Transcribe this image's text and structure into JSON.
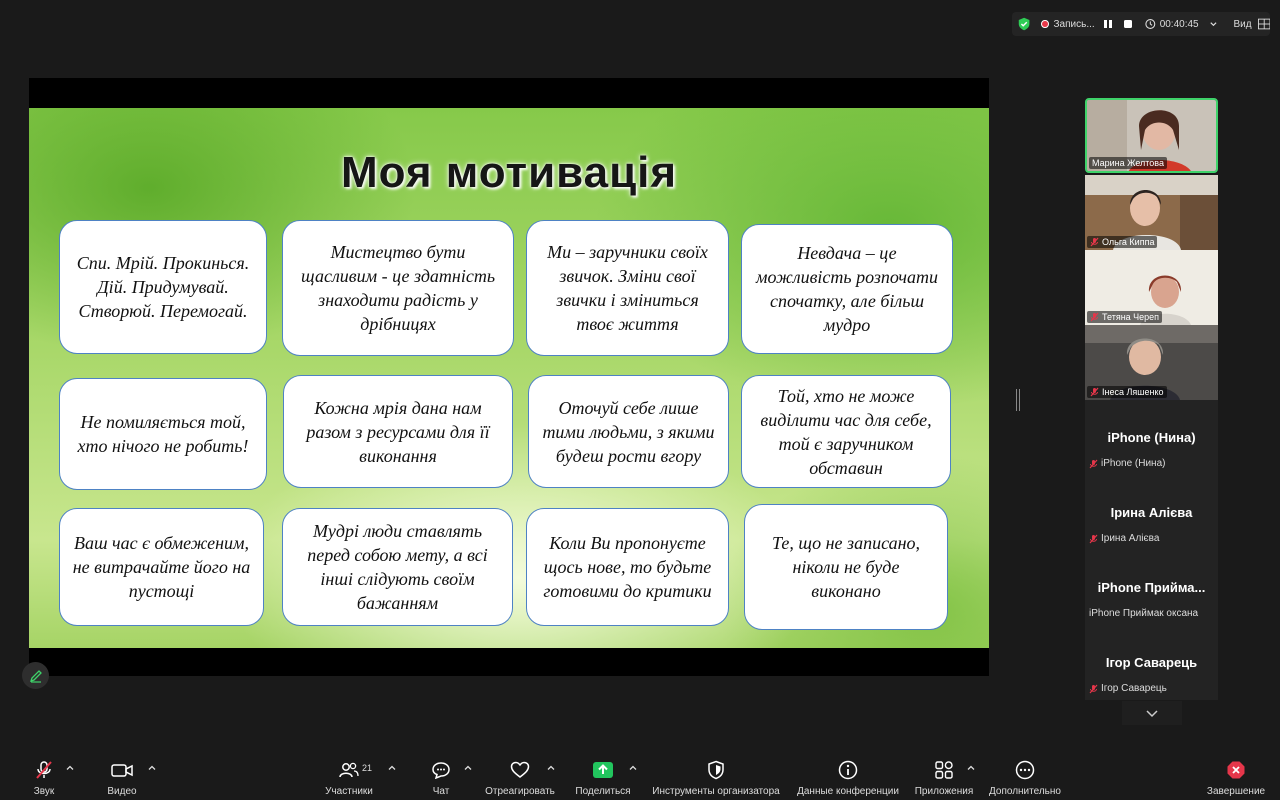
{
  "status_bar": {
    "recording_label": "Запись...",
    "timer": "00:40:45",
    "view_label": "Вид"
  },
  "slide": {
    "title": "Моя мотивація",
    "cards": [
      "Спи. Мрій. Прокинься. Дій. Придумувай. Створюй. Перемогай.",
      "Мистецтво бути щасливим - це здатність знаходити радість у дрібницях",
      "Ми – заручники своїх звичок. Зміни свої звички і зміниться твоє життя",
      "Невдача – це можливість розпочати спочатку, але більш мудро",
      "Не помиляється той, хто нічого не робить!",
      "Кожна мрія дана нам разом з ресурсами для її виконання",
      "Оточуй себе лише тими людьми, з якими будеш рости вгору",
      "Той, хто не може виділити час для себе, той є заручником обставин",
      "Ваш час є обмеженим, не витрачайте його на пустощі",
      "Мудрі люди ставлять перед собою мету, а всі інші слідують своїм бажанням",
      "Коли Ви пропонуєте щось нове, то будьте готовими до критики",
      "Те, що не записано, ніколи не буде виконано"
    ]
  },
  "participants": {
    "videos": [
      {
        "name": "Марина Желтова",
        "muted": false
      },
      {
        "name": "Ольга Киппа",
        "muted": true
      },
      {
        "name": "Тетяна Череп",
        "muted": true
      },
      {
        "name": "Інеса Ляшенко",
        "muted": true
      }
    ],
    "tiles": [
      {
        "display": "iPhone (Нина)",
        "name": "iPhone (Нина)",
        "muted": true
      },
      {
        "display": "Ірина Алієва",
        "name": "Ірина Алієва",
        "muted": true
      },
      {
        "display": "iPhone Прийма...",
        "name": "iPhone Приймак оксана",
        "muted": false
      },
      {
        "display": "Ігор Саварець",
        "name": "Ігор Саварець",
        "muted": true
      }
    ]
  },
  "toolbar": {
    "audio": "Звук",
    "video": "Видео",
    "participants": "Участники",
    "participants_count": "21",
    "chat": "Чат",
    "react": "Отреагировать",
    "share": "Поделиться",
    "host_tools": "Инструменты организатора",
    "meeting_info": "Данные конференции",
    "apps": "Приложения",
    "more": "Дополнительно",
    "end": "Завершение"
  },
  "colors": {
    "accent_green": "#3fd36a",
    "share_green": "#22c55e",
    "end_red": "#e5364a",
    "card_border": "#4e82c4"
  }
}
